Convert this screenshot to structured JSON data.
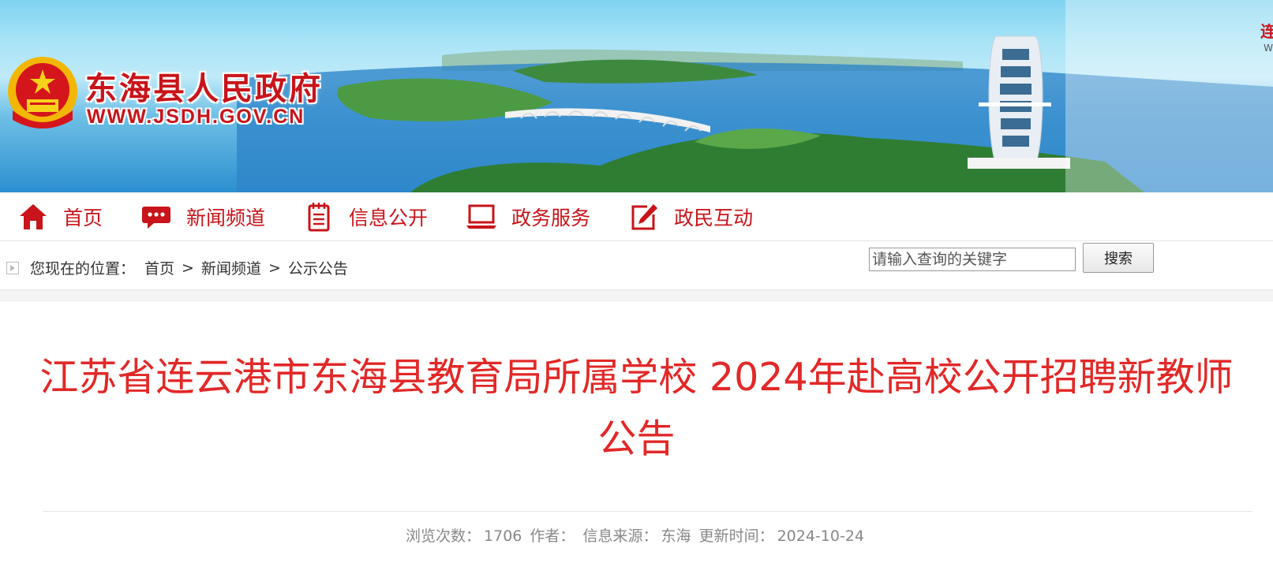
{
  "banner": {
    "site_title": "东海县人民政府",
    "site_url": "WWW.JSDH.GOV.CN",
    "corner_text": "连",
    "corner_sub": "W"
  },
  "nav": {
    "items": [
      {
        "label": "首页",
        "icon": "home-icon"
      },
      {
        "label": "新闻频道",
        "icon": "chat-bubble-icon"
      },
      {
        "label": "信息公开",
        "icon": "notepad-icon"
      },
      {
        "label": "政务服务",
        "icon": "laptop-icon"
      },
      {
        "label": "政民互动",
        "icon": "edit-icon"
      }
    ]
  },
  "breadcrumb": {
    "prefix": "您现在的位置：",
    "items": [
      "首页",
      "新闻频道",
      "公示公告"
    ],
    "separator": ">"
  },
  "search": {
    "placeholder": "请输入查询的关键字",
    "button_label": "搜索"
  },
  "article": {
    "title": "江苏省连云港市东海县教育局所属学校 2024年赴高校公开招聘新教师公告",
    "meta": {
      "views_label": "浏览次数：",
      "views": "1706",
      "author_label": "作者：",
      "source_label": "信息来源：",
      "source": "东海",
      "updated_label": "更新时间：",
      "updated": "2024-10-24"
    }
  },
  "colors": {
    "brand_red": "#c8141a",
    "title_red": "#e22828"
  }
}
